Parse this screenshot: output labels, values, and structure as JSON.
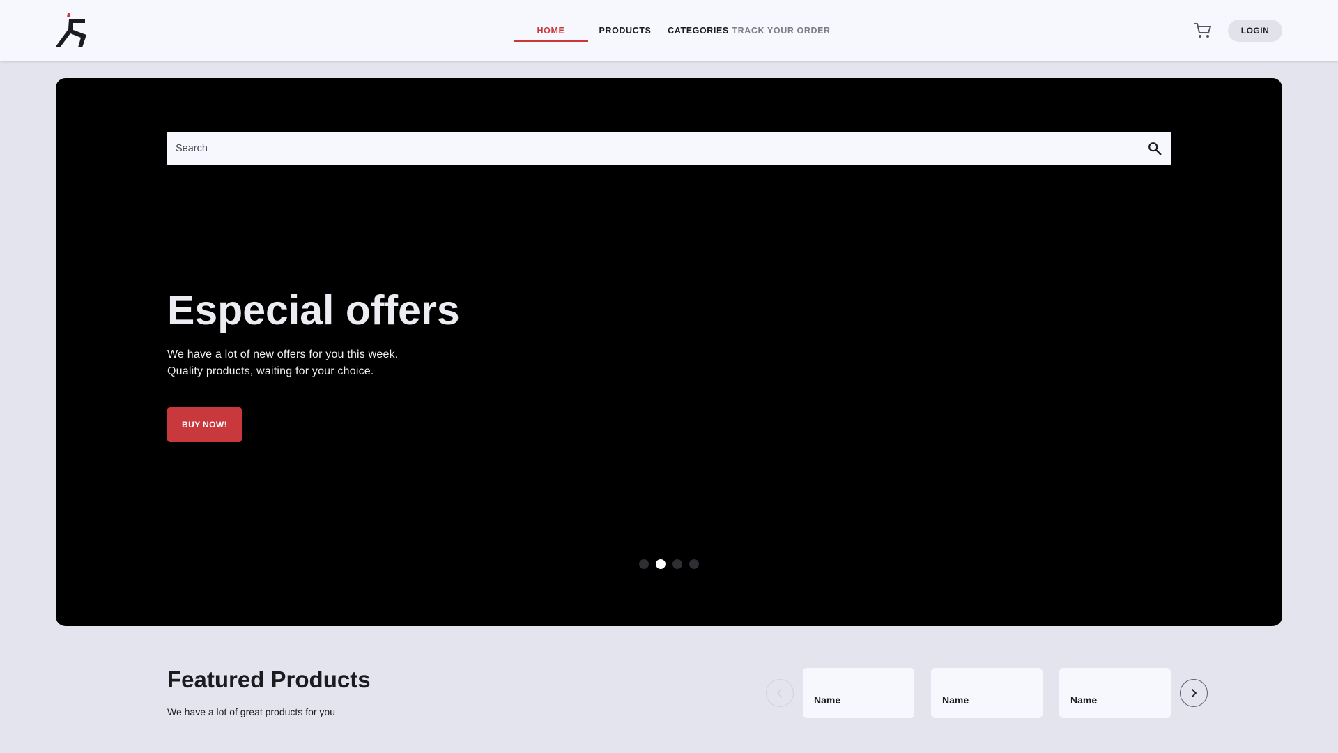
{
  "header": {
    "nav": [
      {
        "label": "HOME",
        "active": true
      },
      {
        "label": "PRODUCTS",
        "active": false
      },
      {
        "label": "CATEGORIES",
        "active": false
      },
      {
        "label": "TRACK YOUR ORDER",
        "active": false
      }
    ],
    "cart_icon": "shopping-cart-icon",
    "login_label": "LOGIN"
  },
  "hero": {
    "search": {
      "placeholder": "Search",
      "value": "",
      "icon": "search-icon"
    },
    "title": "Especial offers",
    "subtitle_line1": "We have a lot of new offers for you this week.",
    "subtitle_line2": "Quality products, waiting for your choice.",
    "cta_label": "BUY NOW!",
    "carousel": {
      "slide_count": 4,
      "active_index": 1
    }
  },
  "featured": {
    "title": "Featured Products",
    "subtitle": "We have a lot of great products for you",
    "prev_icon": "chevron-left-icon",
    "next_icon": "chevron-right-icon",
    "cards": [
      {
        "name": "Name"
      },
      {
        "name": "Name"
      },
      {
        "name": "Name"
      }
    ]
  },
  "colors": {
    "accent": "#c8383d",
    "page_background": "#e4e4ee",
    "header_background": "#f7f8fd",
    "hero_background": "#000000"
  }
}
